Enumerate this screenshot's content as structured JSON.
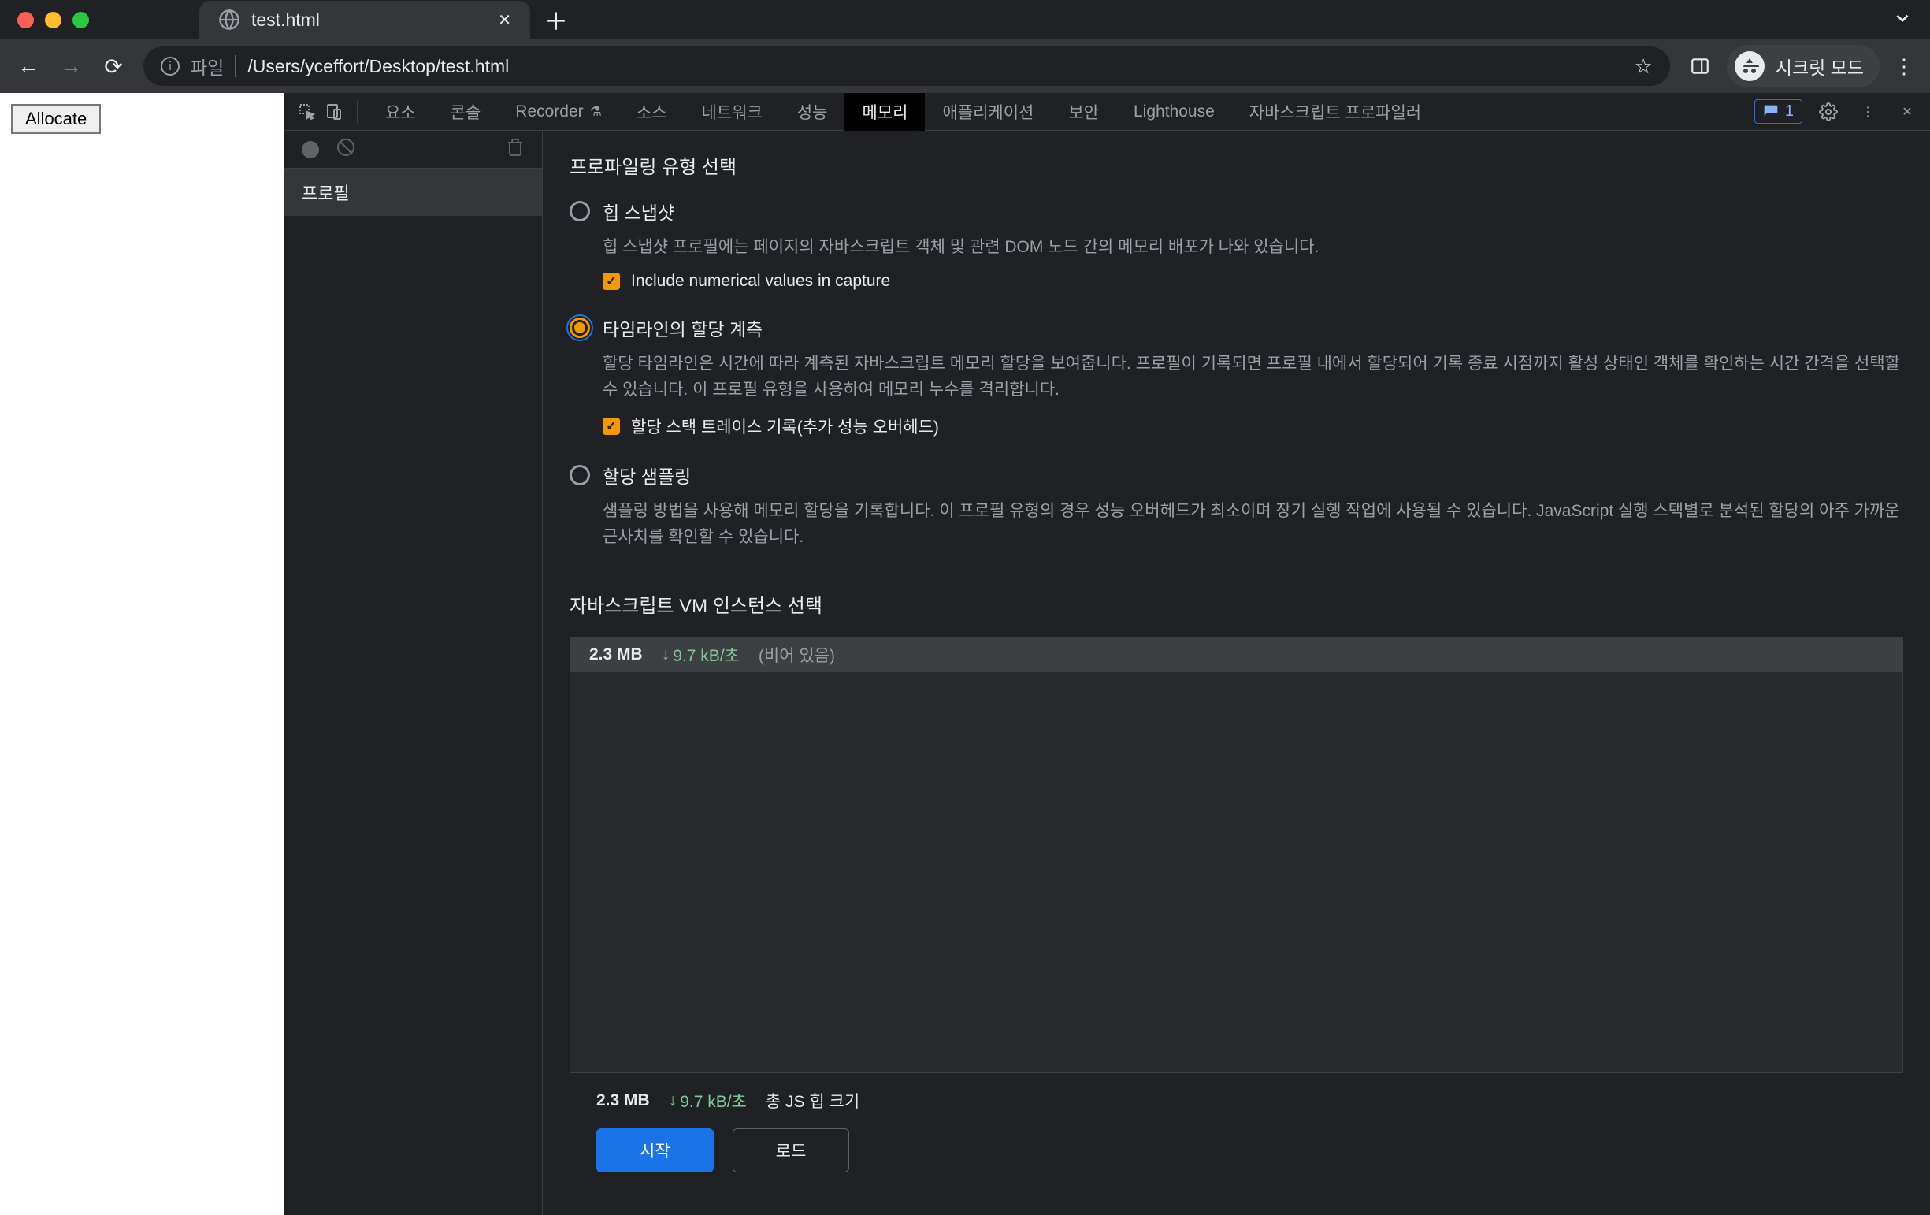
{
  "browser": {
    "tab_title": "test.html",
    "address_label": "파일",
    "address_path": "/Users/yceffort/Desktop/test.html",
    "incognito_label": "시크릿 모드"
  },
  "page": {
    "button_label": "Allocate"
  },
  "devtools": {
    "tabs": [
      "요소",
      "콘솔",
      "Recorder",
      "소스",
      "네트워크",
      "성능",
      "메모리",
      "애플리케이션",
      "보안",
      "Lighthouse",
      "자바스크립트 프로파일러"
    ],
    "active_tab_index": 6,
    "issues_count": "1",
    "sidebar": {
      "profile_label": "프로필"
    },
    "memory": {
      "select_type_title": "프로파일링 유형 선택",
      "options": [
        {
          "label": "힙 스냅샷",
          "desc": "힙 스냅샷 프로필에는 페이지의 자바스크립트 객체 및 관련 DOM 노드 간의 메모리 배포가 나와 있습니다.",
          "selected": false,
          "sub_checked": true,
          "sub_label": "Include numerical values in capture"
        },
        {
          "label": "타임라인의 할당 계측",
          "desc": "할당 타임라인은 시간에 따라 계측된 자바스크립트 메모리 할당을 보여줍니다. 프로필이 기록되면 프로필 내에서 할당되어 기록 종료 시점까지 활성 상태인 객체를 확인하는 시간 간격을 선택할 수 있습니다. 이 프로필 유형을 사용하여 메모리 누수를 격리합니다.",
          "selected": true,
          "sub_checked": true,
          "sub_label": "할당 스택 트레이스 기록(추가 성능 오버헤드)"
        },
        {
          "label": "할당 샘플링",
          "desc": "샘플링 방법을 사용해 메모리 할당을 기록합니다. 이 프로필 유형의 경우 성능 오버헤드가 최소이며 장기 실행 작업에 사용될 수 있습니다. JavaScript 실행 스택별로 분석된 할당의 아주 가까운 근사치를 확인할 수 있습니다.",
          "selected": false
        }
      ],
      "vm_title": "자바스크립트 VM 인스턴스 선택",
      "vm_instance": {
        "memory": "2.3 MB",
        "rate": "9.7 kB/초",
        "status": "(비어 있음)"
      },
      "footer": {
        "memory": "2.3 MB",
        "rate": "9.7 kB/초",
        "label": "총 JS 힙 크기"
      },
      "start_button": "시작",
      "load_button": "로드"
    }
  }
}
